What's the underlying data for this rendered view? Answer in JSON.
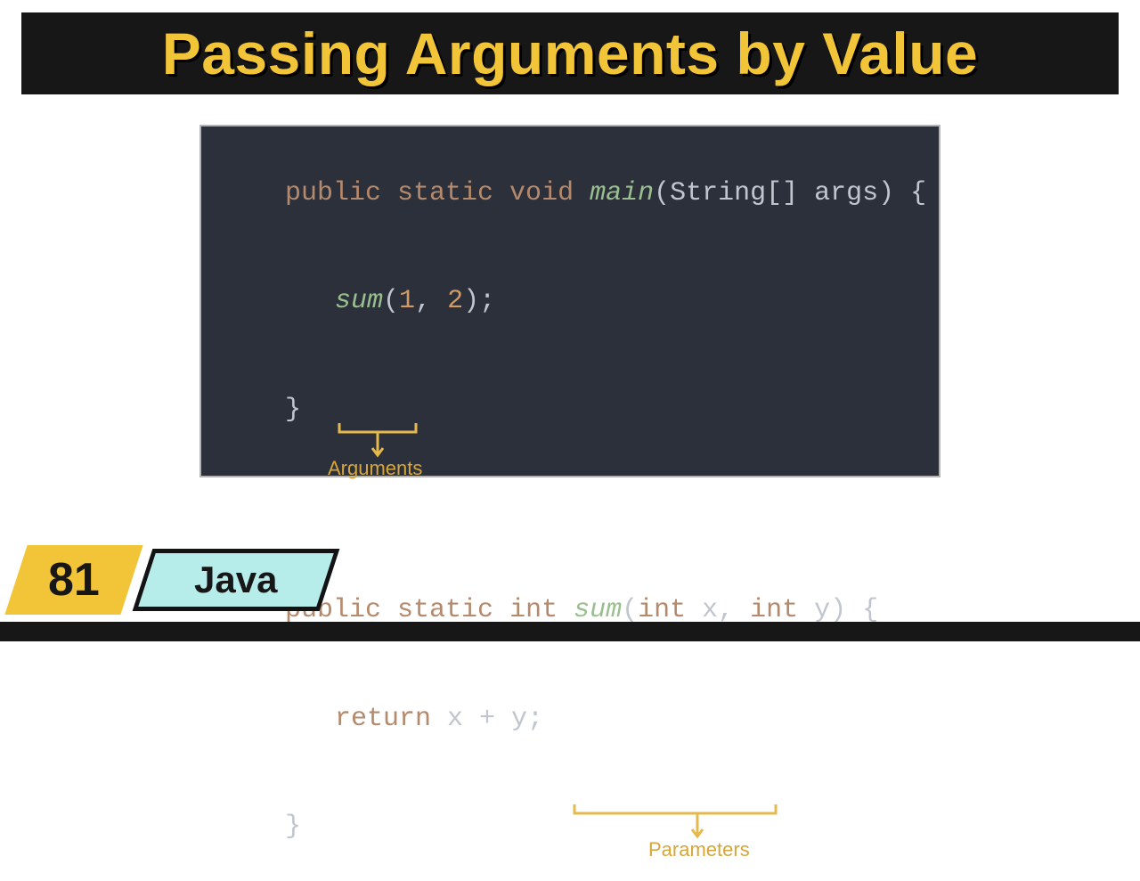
{
  "title": "Passing Arguments by Value",
  "lesson_number": "81",
  "language_label": "Java",
  "code": {
    "main_sig": {
      "kw1": "public static void ",
      "fn": "main",
      "args": "(String[] args) {"
    },
    "main_body": {
      "call": "sum",
      "open": "(",
      "a1": "1",
      "comma": ", ",
      "a2": "2",
      "close": ");"
    },
    "main_close": "}",
    "sum_sig": {
      "kw1": "public static ",
      "rettype": "int ",
      "fn": "sum",
      "open": "(",
      "p1t": "int ",
      "p1n": "x",
      "comma": ", ",
      "p2t": "int ",
      "p2n": "y",
      "close": ") {"
    },
    "sum_body": {
      "kw": "return ",
      "expr": "x + y;"
    },
    "sum_close": "}"
  },
  "annotations": {
    "arguments": "Arguments",
    "parameters": "Parameters"
  }
}
